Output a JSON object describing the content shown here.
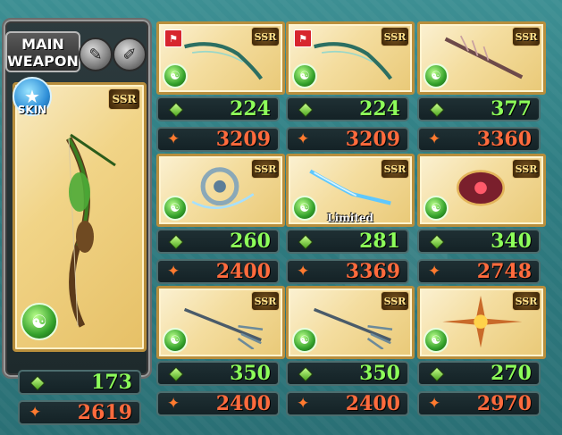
{
  "main": {
    "label": "MAIN WEAPON",
    "label_line1": "MAIN",
    "label_line2": "WEAPON",
    "skin_label": "SKIN",
    "rarity": "SSR",
    "element_icon": "wind-icon",
    "hp": "173",
    "atk": "2619"
  },
  "grid": [
    {
      "rarity": "SSR",
      "hp": "224",
      "atk": "3209",
      "limited": "",
      "flag": true,
      "art": "bow-icon"
    },
    {
      "rarity": "SSR",
      "hp": "224",
      "atk": "3209",
      "limited": "",
      "flag": true,
      "art": "bow-icon"
    },
    {
      "rarity": "SSR",
      "hp": "377",
      "atk": "3360",
      "limited": "",
      "flag": false,
      "art": "spear-icon"
    },
    {
      "rarity": "SSR",
      "hp": "260",
      "atk": "2400",
      "limited": "",
      "flag": false,
      "art": "ring-icon"
    },
    {
      "rarity": "SSR",
      "hp": "281",
      "atk": "3369",
      "limited": "Limited",
      "flag": false,
      "art": "blade-icon"
    },
    {
      "rarity": "SSR",
      "hp": "340",
      "atk": "2748",
      "limited": "",
      "flag": false,
      "art": "orb-icon"
    },
    {
      "rarity": "SSR",
      "hp": "350",
      "atk": "2400",
      "limited": "",
      "flag": false,
      "art": "trident-icon"
    },
    {
      "rarity": "SSR",
      "hp": "350",
      "atk": "2400",
      "limited": "",
      "flag": false,
      "art": "trident-icon"
    },
    {
      "rarity": "SSR",
      "hp": "270",
      "atk": "2970",
      "limited": "",
      "flag": false,
      "art": "star-blade-icon"
    }
  ],
  "colors": {
    "hp": "#8dff5a",
    "atk": "#ff6b3d",
    "background": "#2f7d82",
    "card": "#f4dd9f"
  }
}
